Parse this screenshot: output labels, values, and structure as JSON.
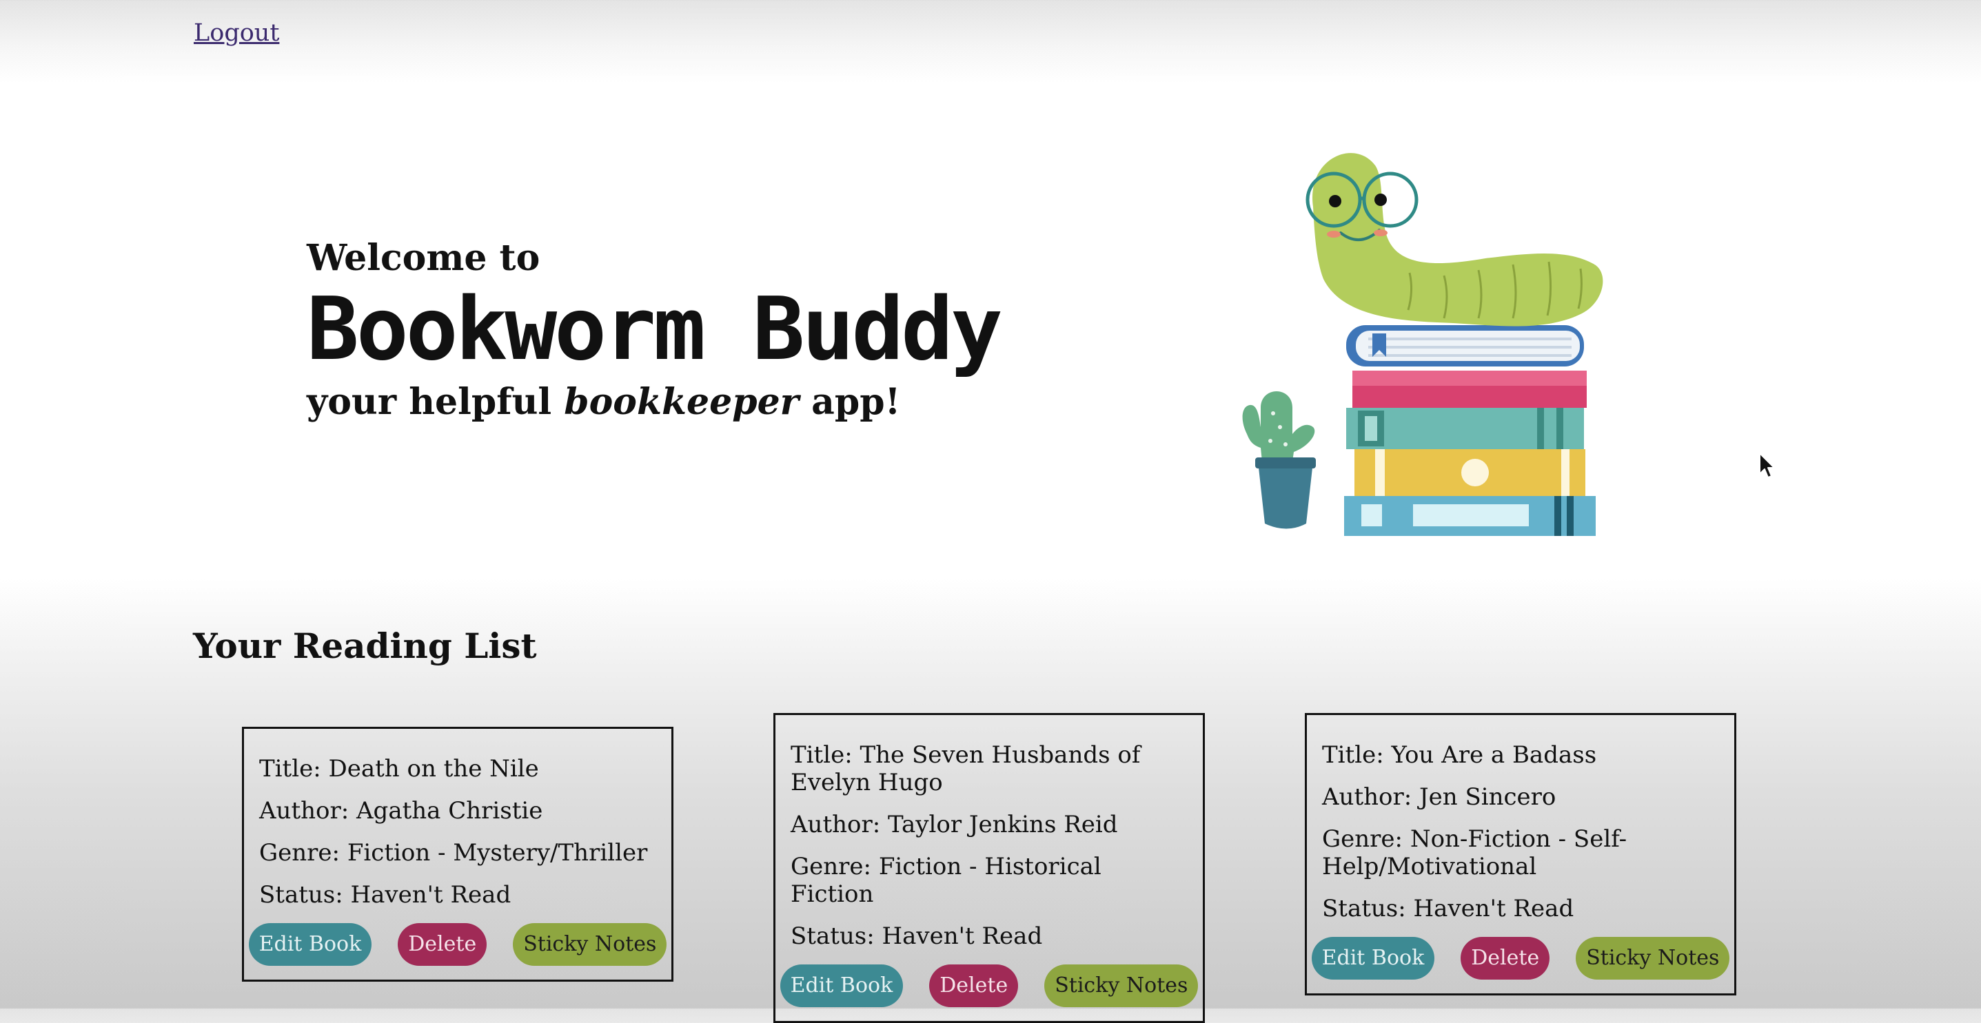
{
  "nav": {
    "logout_label": "Logout"
  },
  "hero": {
    "welcome": "Welcome to",
    "title": "Bookworm Buddy",
    "tagline_pre": "your helpful ",
    "tagline_em": "bookkeeper",
    "tagline_post": " app!"
  },
  "reading_list": {
    "title": "Your Reading List",
    "buttons": {
      "edit": "Edit Book",
      "delete": "Delete",
      "notes": "Sticky Notes"
    },
    "books": [
      {
        "title": "Title: Death on the Nile",
        "author": "Author: Agatha Christie",
        "genre": "Genre: Fiction - Mystery/Thriller",
        "status": "Status: Haven't Read"
      },
      {
        "title": "Title: The Seven Husbands of Evelyn Hugo",
        "author": "Author: Taylor Jenkins Reid",
        "genre": "Genre: Fiction - Historical Fiction",
        "status": "Status: Haven't Read"
      },
      {
        "title": "Title: You Are a Badass",
        "author": "Author: Jen Sincero",
        "genre": "Genre: Non-Fiction - Self-Help/Motivational",
        "status": "Status: Haven't Read"
      }
    ]
  },
  "colors": {
    "edit_button": "#3d8a93",
    "delete_button": "#a02a56",
    "notes_button": "#8ea640",
    "link": "#3b2a6e"
  },
  "icons": {
    "illustration": "bookworm-on-books-illustration",
    "cursor": "mouse-pointer-icon"
  }
}
